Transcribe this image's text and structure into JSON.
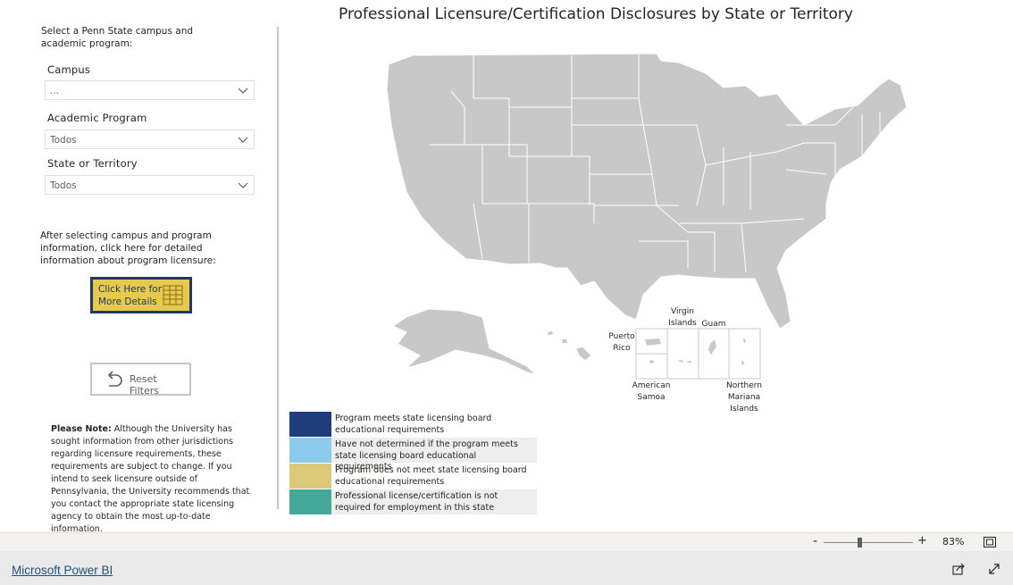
{
  "sidebar": {
    "instructions": "Select a Penn State campus and academic program:",
    "campus": {
      "label": "Campus",
      "value": "..."
    },
    "program": {
      "label": "Academic Program",
      "value": "Todos"
    },
    "state": {
      "label": "State or Territory",
      "value": "Todos"
    },
    "after_text": "After selecting campus and program information, click here for detailed information about program licensure:",
    "details_button": {
      "label": "Click Here for More Details",
      "icon": "table-icon"
    },
    "reset_button": {
      "label": "Reset Filters",
      "icon": "undo-arrow-icon"
    },
    "note": {
      "bold": "Please Note:",
      "text": " Although the University has sought information from other jurisdictions regarding licensure requirements, these requirements are subject to change. If you intend to seek licensure outside of Pennsylvania, the University recommends that you contact the appropriate state licensing agency to obtain the most up-to-date information."
    }
  },
  "main": {
    "title": "Professional Licensure/Certification Disclosures by State or Territory",
    "map_fill": "#c8c8c8",
    "territories": {
      "puerto_rico": "Puerto Rico",
      "virgin_islands": "Virgin Islands",
      "guam": "Guam",
      "american_samoa": "American Samoa",
      "northern_mariana": "Northern Mariana Islands"
    },
    "legend": [
      {
        "color": "#1f3d7a",
        "text": "Program meets state licensing board educational requirements"
      },
      {
        "color": "#8ccbec",
        "text": "Have not determined if the program meets state licensing board educational requirements"
      },
      {
        "color": "#dcc97a",
        "text": "Program does not meet state licensing board educational requirements"
      },
      {
        "color": "#44a998",
        "text": "Professional license/certification is not required for employment in this state"
      }
    ]
  },
  "footer": {
    "zoom_minus": "-",
    "zoom_plus": "+",
    "zoom_value": "83%",
    "zoom_level": 0.4,
    "fit_icon": "fit-to-page-icon"
  },
  "powerbi": {
    "link": "Microsoft Power BI",
    "share_icon": "share-icon",
    "expand_icon": "expand-icon"
  }
}
